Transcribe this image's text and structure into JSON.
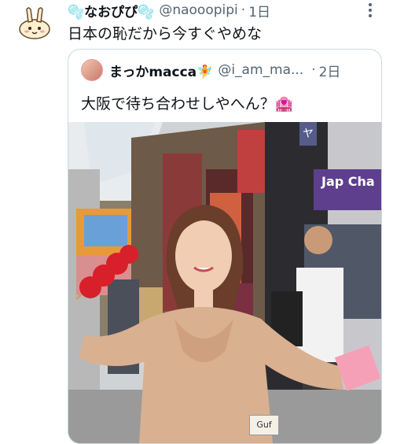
{
  "tweet": {
    "display_name": "🫧なおぴぴ🫧",
    "handle": "@naooopipi",
    "separator": "·",
    "time": "1日",
    "text": "日本の恥だから今すぐやめな",
    "more_icon": "more-vertical-icon"
  },
  "quoted": {
    "display_name": "まっかmacca🧚",
    "handle": "@i_am_ma...",
    "separator": "·",
    "time": "2日",
    "text": "大阪で待ち合わせしやへん？🏩",
    "photo_signs": {
      "right_banner": "Jap Cha",
      "small_sign": "ヤ",
      "shop_sign": "Guf"
    }
  },
  "colors": {
    "text": "#0f1419",
    "secondary": "#536471",
    "border": "#cfd9de"
  }
}
